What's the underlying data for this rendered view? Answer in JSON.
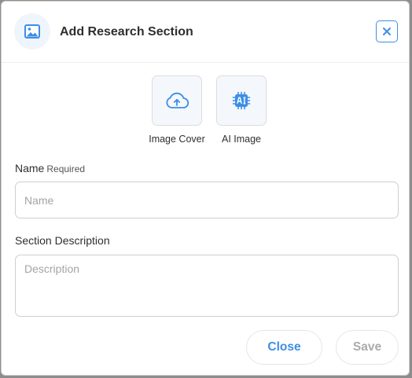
{
  "dialog": {
    "title": "Add Research Section",
    "header_icon": "image-icon",
    "close_icon": "close-icon"
  },
  "media_options": [
    {
      "label": "Image Cover",
      "icon": "cloud-upload-icon"
    },
    {
      "label": "AI Image",
      "icon": "ai-chip-icon"
    }
  ],
  "fields": {
    "name": {
      "label": "Name",
      "required_text": "Required",
      "placeholder": "Name",
      "value": ""
    },
    "description": {
      "label": "Section Description",
      "placeholder": "Description",
      "value": ""
    }
  },
  "actions": {
    "close_label": "Close",
    "save_label": "Save"
  },
  "colors": {
    "accent": "#3d8ee6",
    "disabled_text": "#aaaaaa",
    "tile_bg": "#f4f8fd"
  }
}
